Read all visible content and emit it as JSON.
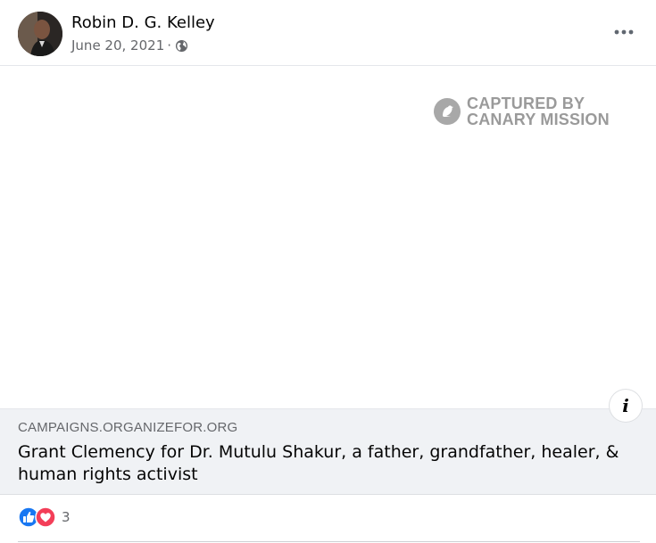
{
  "post": {
    "author": "Robin D. G. Kelley",
    "date": "June 20, 2021",
    "separator": "·",
    "privacy_icon": "globe-icon",
    "menu_icon": "more-options-icon"
  },
  "media": {
    "watermark_line1": "CAPTURED BY",
    "watermark_line2": "CANARY MISSION",
    "info_label": "i"
  },
  "link_preview": {
    "domain": "CAMPAIGNS.ORGANIZEFOR.ORG",
    "title": "Grant Clemency for Dr. Mutulu Shakur, a father, grandfather, healer, & human rights activist"
  },
  "reactions": {
    "icons": [
      "like-icon",
      "love-icon"
    ],
    "count": "3"
  },
  "colors": {
    "like": "#1877f2",
    "love": "#f33e58",
    "secondary_text": "#65676b",
    "link_bg": "#f0f2f5"
  }
}
